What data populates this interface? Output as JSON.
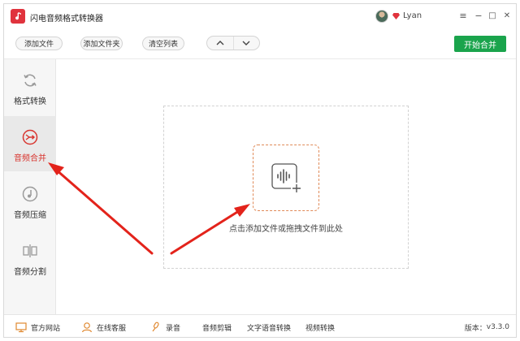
{
  "app": {
    "title": "闪电音频格式转换器",
    "username": "Lyan"
  },
  "window_controls": {
    "menu": "≡",
    "minimize": "−",
    "maximize": "□",
    "close": "✕"
  },
  "toolbar": {
    "add_file": "添加文件",
    "add_folder": "添加文件夹",
    "clear_list": "清空列表",
    "start_merge": "开始合并"
  },
  "sidebar": {
    "items": [
      {
        "label": "格式转换",
        "icon": "refresh-icon"
      },
      {
        "label": "音频合并",
        "icon": "merge-icon",
        "active": true
      },
      {
        "label": "音频压缩",
        "icon": "compress-icon"
      },
      {
        "label": "音频分割",
        "icon": "split-icon"
      }
    ]
  },
  "main": {
    "drop_text": "点击添加文件或拖拽文件到此处"
  },
  "footer": {
    "website": "官方网站",
    "support": "在线客服",
    "record": "录音",
    "audio_edit": "音频剪辑",
    "tts": "文字语音转换",
    "video_convert": "视频转换",
    "version_label": "版本：",
    "version": "v3.3.0"
  },
  "colors": {
    "accent_red": "#d8352f",
    "merge_green": "#1aa44c",
    "drop_orange": "#e08a58"
  }
}
